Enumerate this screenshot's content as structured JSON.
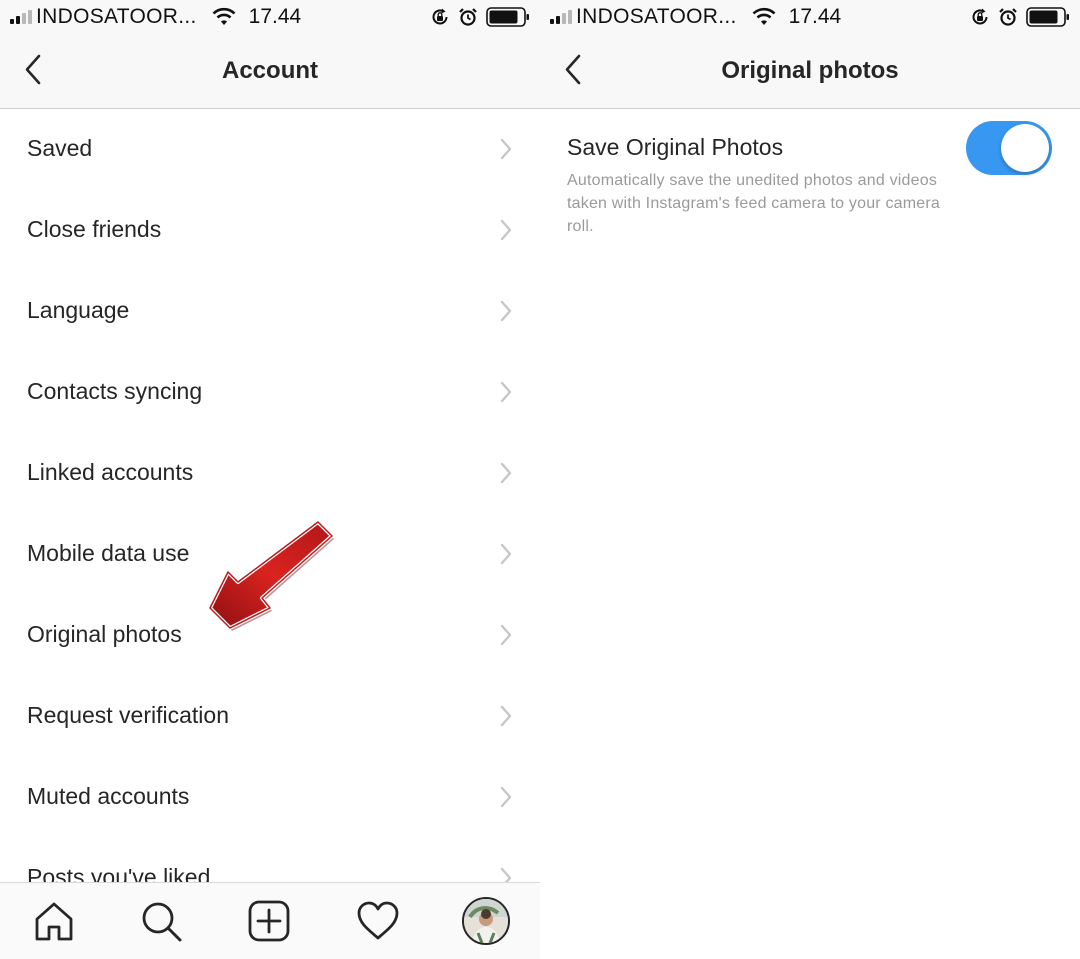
{
  "status_bar": {
    "carrier": "INDOSATOOR...",
    "time": "17.44"
  },
  "left_screen": {
    "title": "Account",
    "menu_items": [
      "Saved",
      "Close friends",
      "Language",
      "Contacts syncing",
      "Linked accounts",
      "Mobile data use",
      "Original photos",
      "Request verification",
      "Muted accounts",
      "Posts you've liked"
    ],
    "tabs": [
      "home-icon",
      "search-icon",
      "new-post-icon",
      "activity-heart-icon",
      "profile-avatar"
    ]
  },
  "right_screen": {
    "title": "Original photos",
    "setting": {
      "label": "Save Original Photos",
      "description": "Automatically save the unedited photos and videos taken with Instagram's feed camera to your camera roll.",
      "enabled": true
    }
  },
  "colors": {
    "accent": "#3897f0",
    "annotation_arrow": "#c0181a",
    "text": "#262626",
    "muted": "#9a9a9a"
  }
}
